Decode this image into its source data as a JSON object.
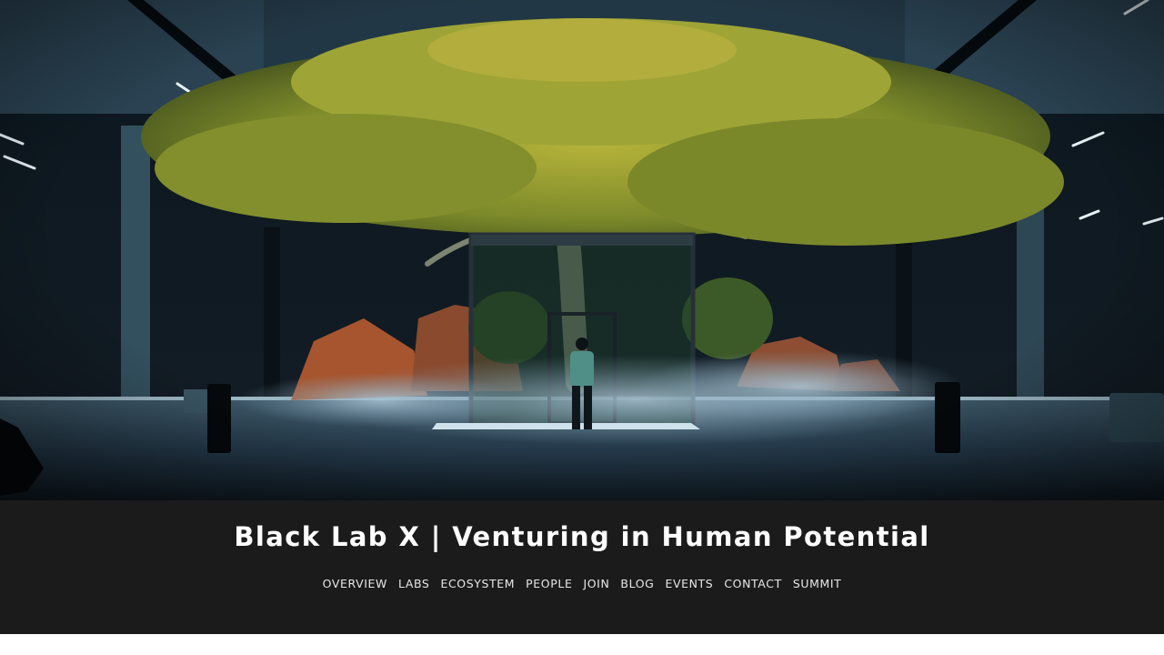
{
  "site": {
    "title": "Black Lab X | Venturing in Human Potential"
  },
  "hero": {
    "image_alt": "Giant tree in a dark concrete hall with a person standing in a glass frame amid mist"
  },
  "nav": {
    "items": [
      {
        "label": "OVERVIEW"
      },
      {
        "label": "LABS"
      },
      {
        "label": "ECOSYSTEM"
      },
      {
        "label": "PEOPLE"
      },
      {
        "label": "JOIN"
      },
      {
        "label": "BLOG"
      },
      {
        "label": "EVENTS"
      },
      {
        "label": "CONTACT"
      },
      {
        "label": "SUMMIT"
      }
    ]
  },
  "colors": {
    "banner_bg": "#1b1b1b",
    "title_text": "#ffffff",
    "nav_text": "#e8e8e8",
    "hall_dark": "#0b1319",
    "foliage": "#8f9b2e"
  }
}
